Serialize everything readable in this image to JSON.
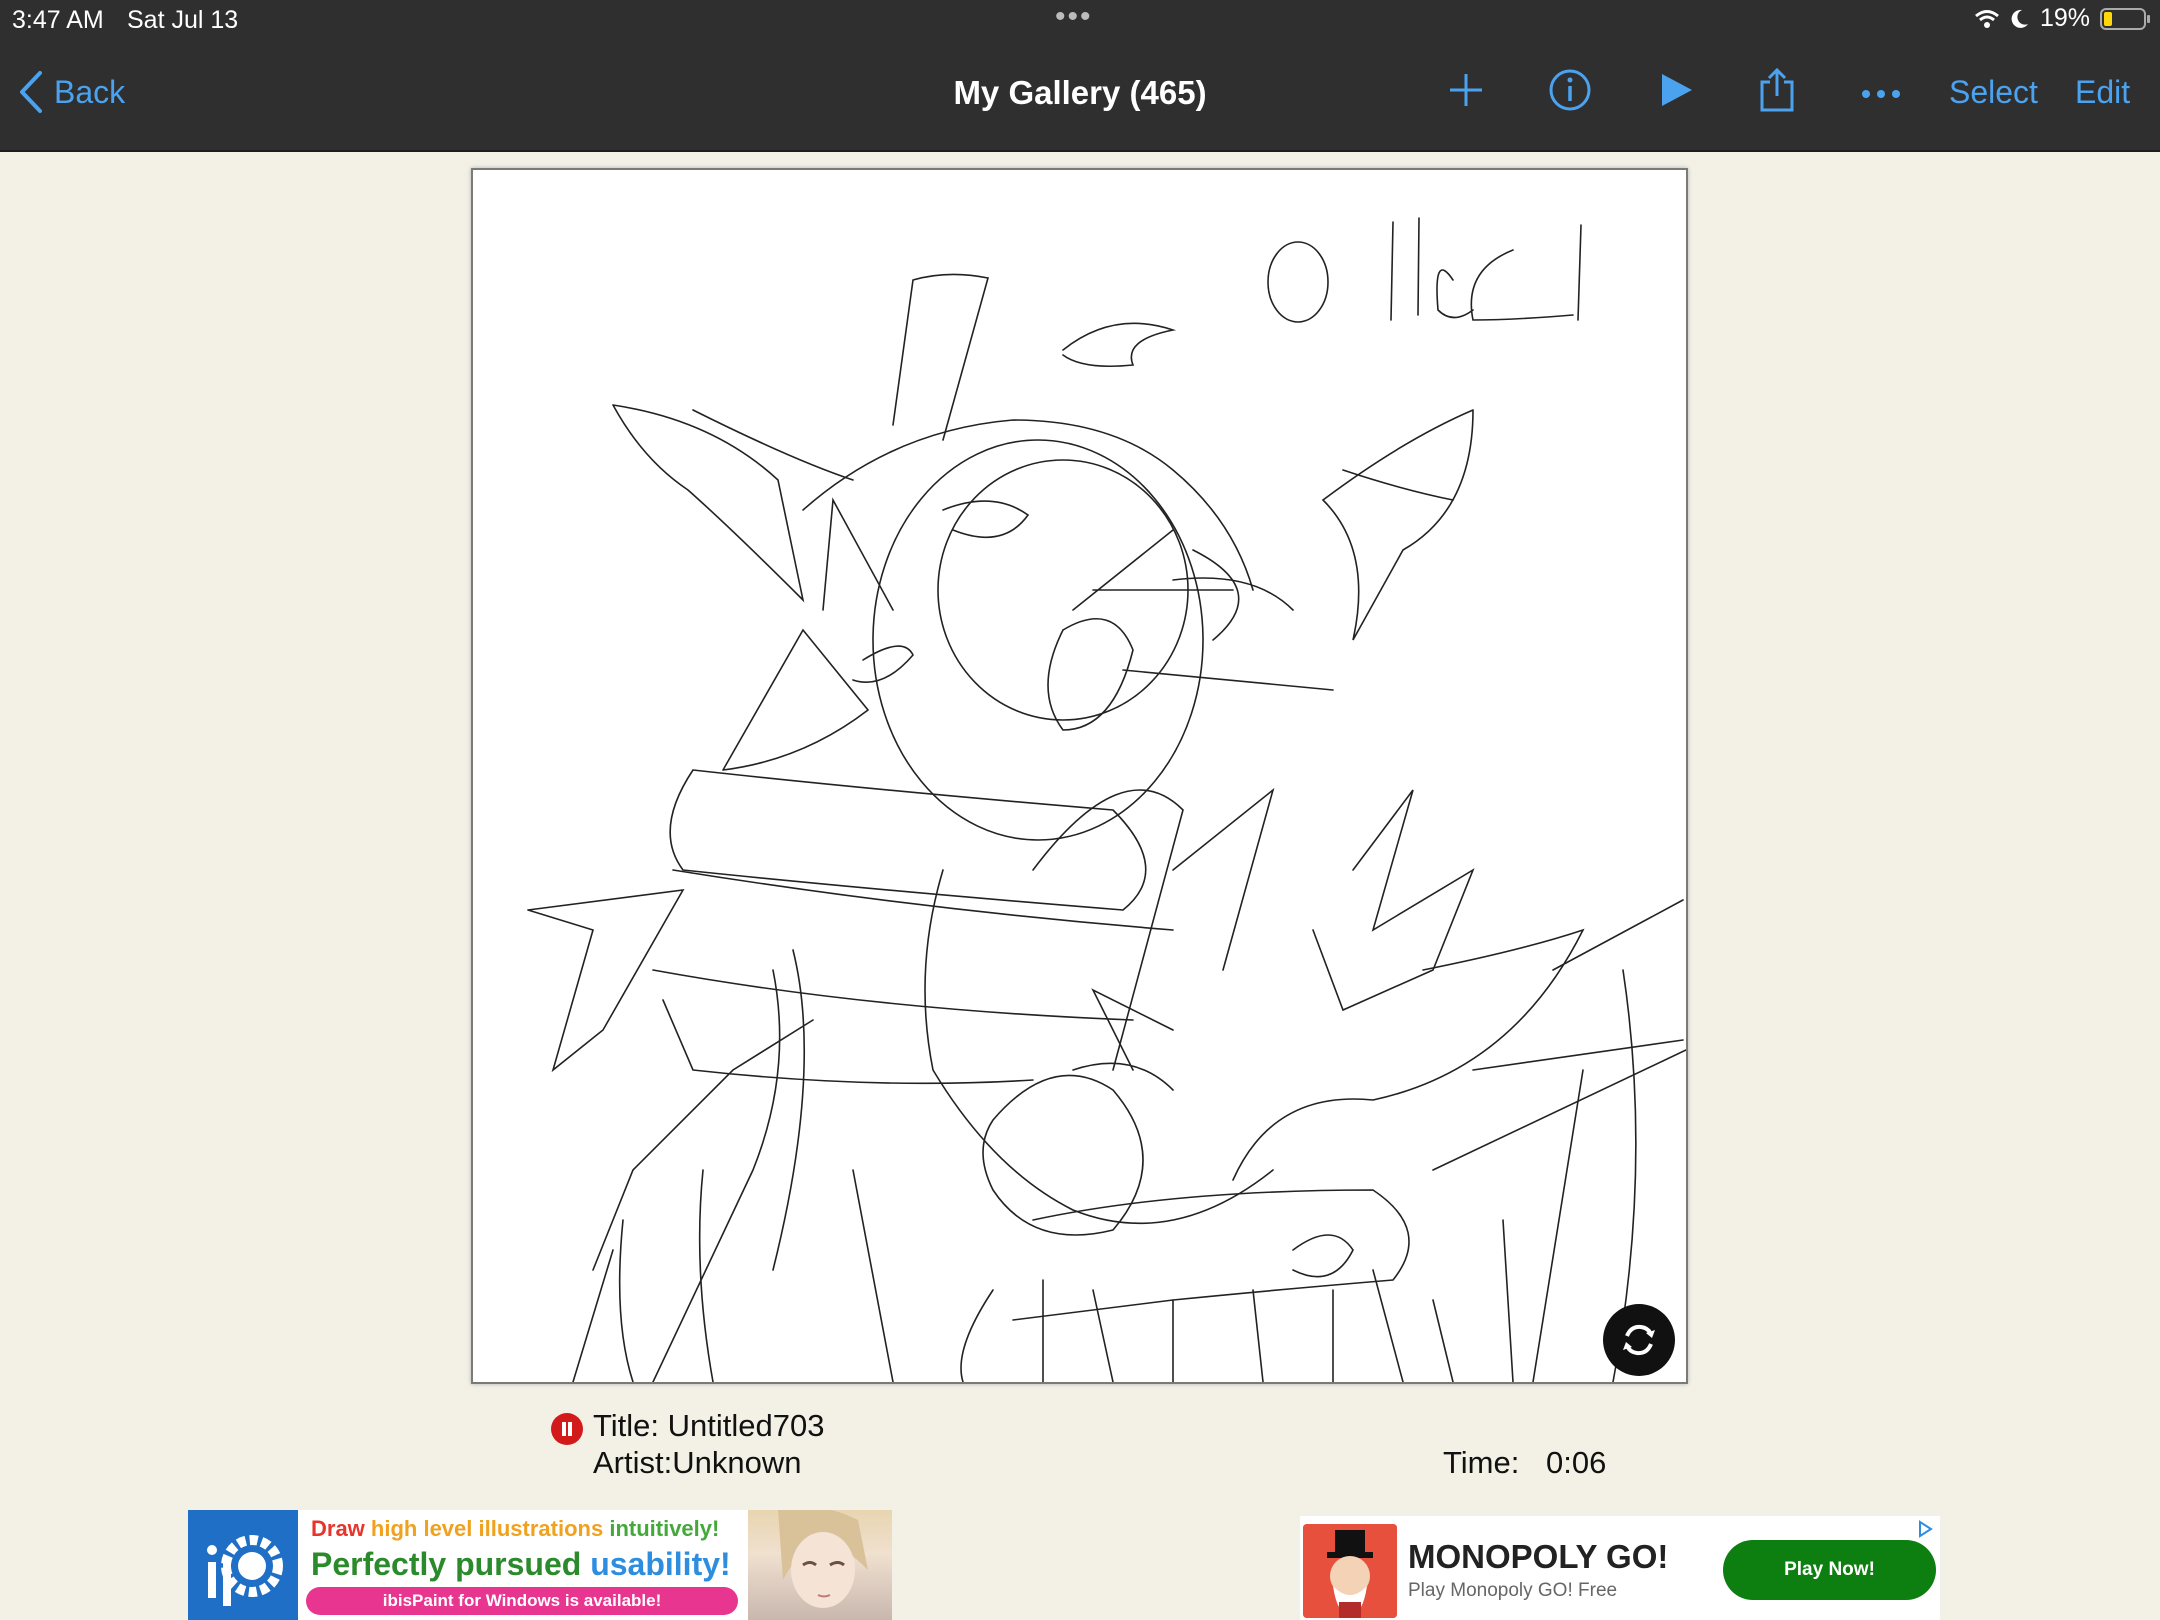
{
  "status_bar": {
    "time": "3:47 AM",
    "date": "Sat Jul 13",
    "battery": "19%",
    "battery_level": 0.19
  },
  "nav": {
    "back_label": "Back",
    "title": "My Gallery (465)",
    "select_label": "Select",
    "edit_label": "Edit",
    "icons": [
      "plus-icon",
      "info-icon",
      "play-icon",
      "share-icon",
      "more-icon"
    ]
  },
  "artwork": {
    "title": "Title: Untitled703",
    "artist": "Artist:Unknown",
    "time_label": "Time:",
    "time_value": "0:06",
    "signature": "ollie"
  },
  "ads": {
    "ibis": {
      "line1_a": "Draw",
      "line1_b": "high level illustrations",
      "line1_c": "intuitively!",
      "line2_a": "Perfectly pursued",
      "line2_b": "usability!",
      "pill": "ibisPaint for Windows is available!"
    },
    "monopoly": {
      "name": "MONOPOLY GO!",
      "sub": "Play Monopoly GO! Free",
      "cta": "Play Now!"
    }
  },
  "colors": {
    "bar_bg": "#2f2f2f",
    "accent": "#4ba3f0",
    "page_bg": "#f3f1e6",
    "record_red": "#d21a1a",
    "cta_green": "#0d7e10"
  }
}
